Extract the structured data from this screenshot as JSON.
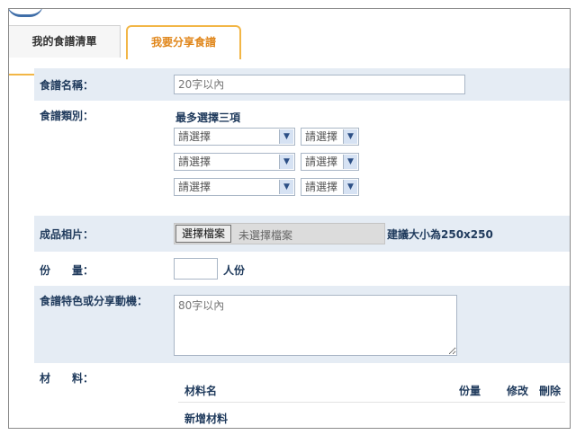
{
  "tabs": [
    {
      "label": "我的食譜清單"
    },
    {
      "label": "我要分享食譜"
    }
  ],
  "form": {
    "name": {
      "label": "食譜名稱：",
      "placeholder": "20字以內"
    },
    "category": {
      "label": "食譜類別：",
      "hint": "最多選擇三項",
      "selects": [
        {
          "primary": "請選擇",
          "secondary": "請選擇"
        },
        {
          "primary": "請選擇",
          "secondary": "請選擇"
        },
        {
          "primary": "請選擇",
          "secondary": "請選擇"
        }
      ]
    },
    "photo": {
      "label": "成品相片：",
      "button": "選擇檔案",
      "status": "未選擇檔案",
      "hint": "建議大小為250x250"
    },
    "servings": {
      "label": "份　　量：",
      "unit": "人份",
      "value": ""
    },
    "feature": {
      "label": "食譜特色或分享動機：",
      "placeholder": "80字以內"
    },
    "ingredients": {
      "label": "材　　料：",
      "columns": [
        "材料名",
        "份量",
        "修改",
        "刪除"
      ],
      "add_label": "新增材料"
    }
  },
  "icons": {
    "dropdown": "chevron-down-icon"
  }
}
